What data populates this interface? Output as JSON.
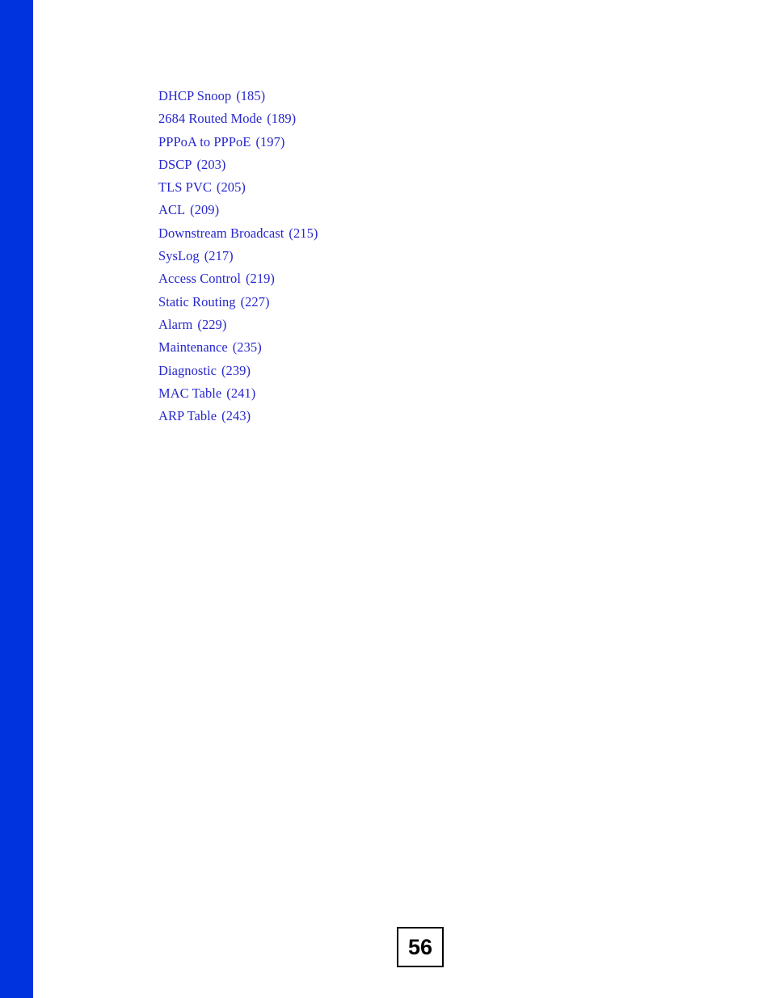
{
  "document": {
    "page_number": "56",
    "accent_bar_color": "#0033DD",
    "link_color": "#2727CC",
    "page_background": "#ffffff",
    "page_number_border_color": "#000000"
  },
  "toc": {
    "entries": [
      {
        "title": "DHCP Snoop",
        "page": "(185)"
      },
      {
        "title": "2684 Routed Mode",
        "page": "(189)"
      },
      {
        "title": "PPPoA to PPPoE",
        "page": "(197)"
      },
      {
        "title": "DSCP",
        "page": "(203)"
      },
      {
        "title": "TLS PVC",
        "page": "(205)"
      },
      {
        "title": "ACL",
        "page": "(209)"
      },
      {
        "title": "Downstream Broadcast",
        "page": "(215)"
      },
      {
        "title": "SysLog",
        "page": "(217)"
      },
      {
        "title": "Access Control",
        "page": "(219)"
      },
      {
        "title": "Static Routing",
        "page": "(227)"
      },
      {
        "title": "Alarm",
        "page": "(229)"
      },
      {
        "title": "Maintenance",
        "page": "(235)"
      },
      {
        "title": "Diagnostic",
        "page": "(239)"
      },
      {
        "title": "MAC Table",
        "page": "(241)"
      },
      {
        "title": "ARP Table",
        "page": "(243)"
      }
    ]
  }
}
